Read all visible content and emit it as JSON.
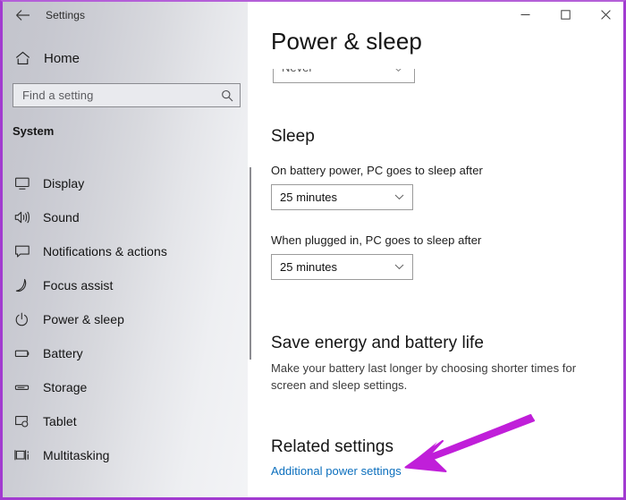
{
  "window": {
    "app_title": "Settings",
    "accent_color": "#a23bd0",
    "controls": [
      {
        "name": "minimize",
        "glyph": "minimize-icon"
      },
      {
        "name": "maximize",
        "glyph": "maximize-icon"
      },
      {
        "name": "close",
        "glyph": "close-icon"
      }
    ]
  },
  "sidebar": {
    "back_label": "Back",
    "home_label": "Home",
    "search": {
      "placeholder": "Find a setting",
      "value": ""
    },
    "group_title": "System",
    "items": [
      {
        "label": "Display",
        "icon": "monitor-icon"
      },
      {
        "label": "Sound",
        "icon": "speaker-icon"
      },
      {
        "label": "Notifications & actions",
        "icon": "notification-icon"
      },
      {
        "label": "Focus assist",
        "icon": "moon-icon"
      },
      {
        "label": "Power & sleep",
        "icon": "power-icon"
      },
      {
        "label": "Battery",
        "icon": "battery-icon"
      },
      {
        "label": "Storage",
        "icon": "storage-icon"
      },
      {
        "label": "Tablet",
        "icon": "tablet-icon"
      },
      {
        "label": "Multitasking",
        "icon": "multitasking-icon"
      }
    ]
  },
  "main": {
    "page_title": "Power & sleep",
    "scrolled_dropdown": {
      "value": "Never"
    },
    "sleep": {
      "heading": "Sleep",
      "battery_label": "On battery power, PC goes to sleep after",
      "battery_value": "25 minutes",
      "plugged_label": "When plugged in, PC goes to sleep after",
      "plugged_value": "25 minutes"
    },
    "save_energy": {
      "heading": "Save energy and battery life",
      "description": "Make your battery last longer by choosing shorter times for screen and sleep settings."
    },
    "related": {
      "heading": "Related settings",
      "link_label": "Additional power settings"
    }
  },
  "annotation": {
    "arrow_color": "#c01fd9",
    "points_to": "Additional power settings"
  }
}
